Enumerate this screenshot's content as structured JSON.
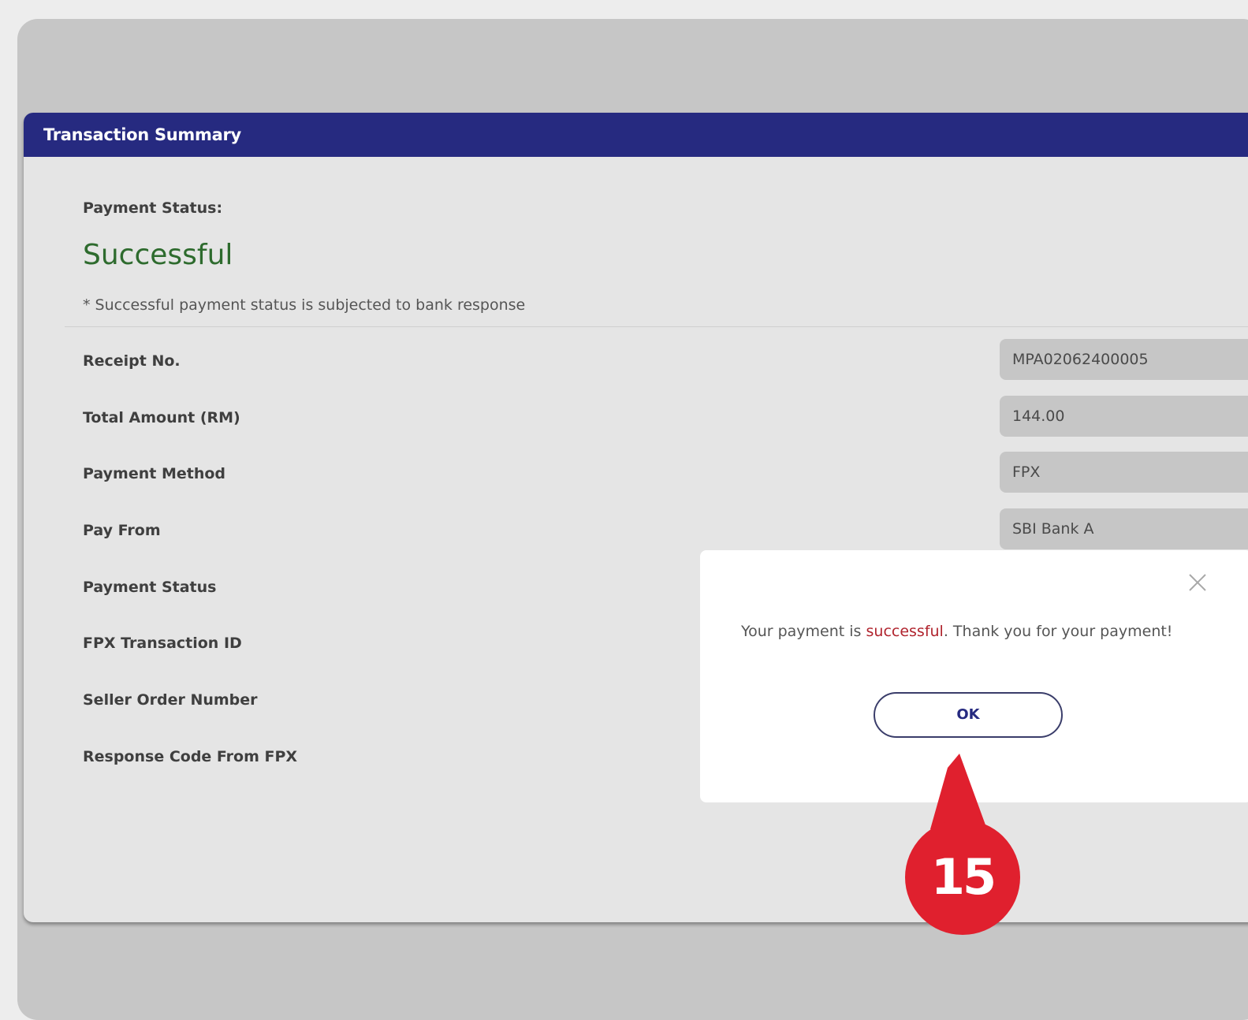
{
  "header": {
    "title": "Transaction Summary"
  },
  "status": {
    "label": "Payment Status:",
    "value": "Successful",
    "note": "* Successful payment status is subjected to bank response"
  },
  "details": [
    {
      "label": "Receipt No.",
      "value": "MPA02062400005"
    },
    {
      "label": "Total Amount (RM)",
      "value": "144.00"
    },
    {
      "label": "Payment Method",
      "value": "FPX"
    },
    {
      "label": "Pay From",
      "value": "SBI Bank A"
    },
    {
      "label": "Payment Status",
      "value": ""
    },
    {
      "label": "FPX Transaction ID",
      "value": ""
    },
    {
      "label": "Seller Order Number",
      "value": ""
    },
    {
      "label": "Response Code From FPX",
      "value": ""
    }
  ],
  "modal": {
    "message_prefix": "Your payment is ",
    "message_highlight": "successful",
    "message_suffix": ". Thank you for your payment!",
    "ok_label": "OK",
    "close_icon": "close-icon"
  },
  "annotation": {
    "step": "15",
    "color": "#e0202e"
  },
  "colors": {
    "header_bg": "#262a80",
    "success_text": "#2e6b2e",
    "highlight_text": "#b0232d"
  }
}
